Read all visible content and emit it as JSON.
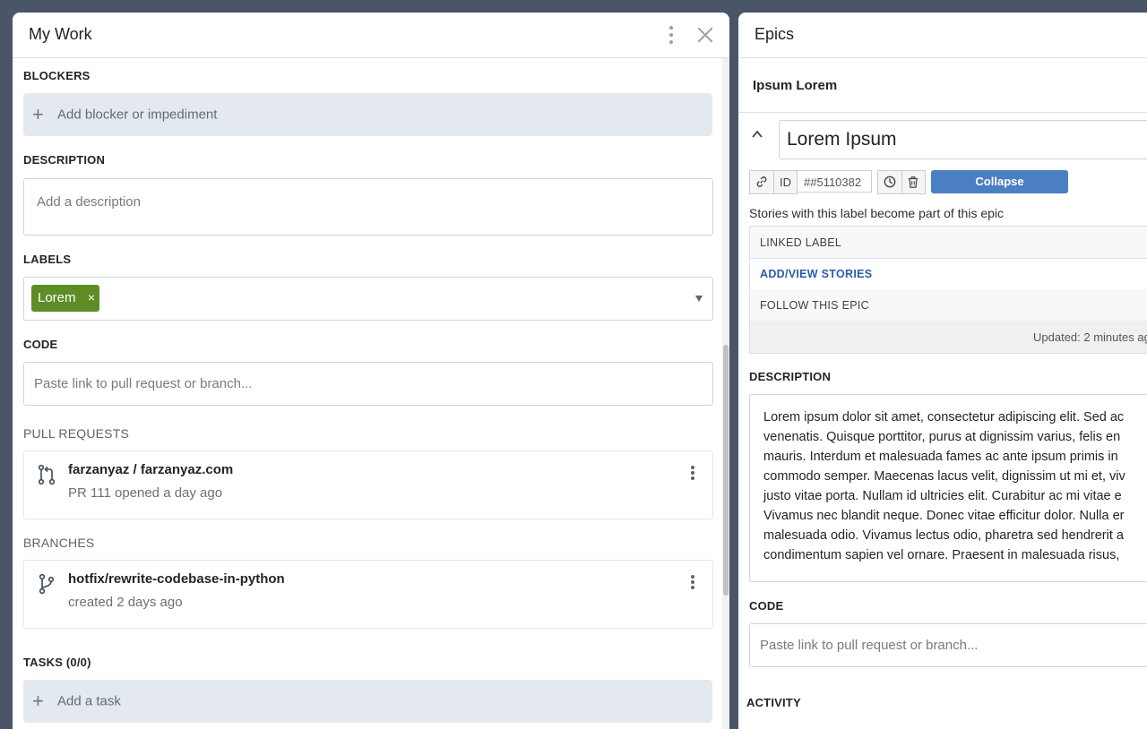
{
  "left": {
    "title": "My Work",
    "blockers": {
      "label": "BLOCKERS",
      "add_text": "Add blocker or impediment"
    },
    "description": {
      "label": "DESCRIPTION",
      "placeholder": "Add a description"
    },
    "labels": {
      "label": "LABELS",
      "chip": "Lorem",
      "chip_remove": "×"
    },
    "code": {
      "label": "CODE",
      "placeholder": "Paste link to pull request or branch..."
    },
    "pull_requests": {
      "label": "PULL REQUESTS",
      "items": [
        {
          "title": "farzanyaz / farzanyaz.com",
          "subtitle": "PR 111 opened a day ago"
        }
      ]
    },
    "branches": {
      "label": "BRANCHES",
      "items": [
        {
          "title": "hotfix/rewrite-codebase-in-python",
          "subtitle": "created 2 days ago"
        }
      ]
    },
    "tasks": {
      "label": "TASKS (0/0)",
      "add_text": "Add a task"
    }
  },
  "right": {
    "title": "Epics",
    "epic_name": "Ipsum Lorem",
    "story_title": "Lorem Ipsum",
    "toolbar": {
      "id_label": "ID",
      "id_value": "##5110382",
      "collapse_label": "Collapse"
    },
    "note": "Stories with this label become part of this epic",
    "rows": {
      "linked_label": "LINKED LABEL",
      "add_view": "ADD/VIEW STORIES",
      "follow": "FOLLOW THIS EPIC"
    },
    "updated": "Updated: 2 minutes ag",
    "description": {
      "label": "DESCRIPTION",
      "lines": [
        "Lorem ipsum dolor sit amet, consectetur adipiscing elit. Sed ac",
        "venenatis. Quisque porttitor, purus at dignissim varius, felis en",
        "mauris. Interdum et malesuada fames ac ante ipsum primis in",
        "commodo semper. Maecenas lacus velit, dignissim ut mi et, viv",
        "justo vitae porta. Nullam id ultricies elit. Curabitur ac mi vitae e",
        "Vivamus nec blandit neque. Donec vitae efficitur dolor. Nulla er",
        "malesuada odio. Vivamus lectus odio, pharetra sed hendrerit a",
        "condimentum sapien vel ornare. Praesent in malesuada risus,"
      ]
    },
    "code": {
      "label": "CODE",
      "placeholder": "Paste link to pull request or branch..."
    },
    "activity_label": "ACTIVITY"
  }
}
